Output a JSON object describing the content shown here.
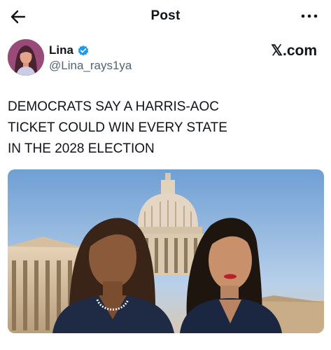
{
  "header": {
    "title": "Post",
    "back_icon": "arrow-left-icon",
    "more_icon": "more-dots-icon"
  },
  "author": {
    "name": "Lina",
    "handle": "@Lina_rays1ya",
    "verified": true,
    "verified_color": "#1d9bf0"
  },
  "brand": {
    "text": "𝕏.com"
  },
  "post": {
    "text": "DEMOCRATS SAY A HARRIS-AOC\nTICKET COULD WIN EVERY STATE\nIN THE 2028 ELECTION"
  },
  "colors": {
    "text": "#0f1419",
    "secondary": "#536471"
  }
}
